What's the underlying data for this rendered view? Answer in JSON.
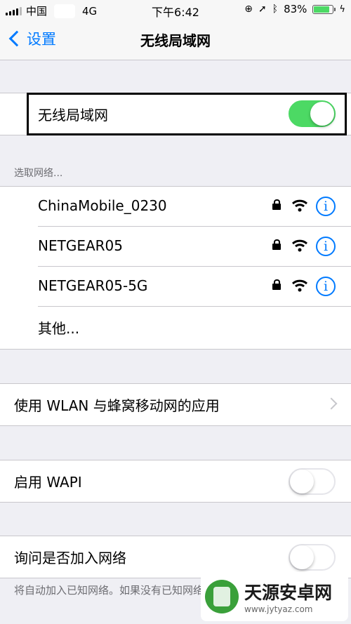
{
  "status_bar": {
    "carrier": "中国",
    "network": "4G",
    "time": "下午6:42",
    "battery": "83%",
    "battery_level": 0.83
  },
  "nav": {
    "back_label": "设置",
    "title": "无线局域网"
  },
  "wifi_toggle": {
    "label": "无线局域网",
    "on": true
  },
  "section_header": "选取网络...",
  "networks": [
    {
      "name": "ChinaMobile_0230",
      "secured": true
    },
    {
      "name": "NETGEAR05",
      "secured": true
    },
    {
      "name": "NETGEAR05-5G",
      "secured": true
    }
  ],
  "other_label": "其他...",
  "wlan_apps_label": "使用 WLAN 与蜂窝移动网的应用",
  "wapi": {
    "label": "启用 WAPI",
    "on": false
  },
  "ask_join": {
    "label": "询问是否加入网络",
    "on": false
  },
  "footer": "将自动加入已知网络。如果没有已知网络，您必须手动选择。",
  "watermark": {
    "title": "天源安卓网",
    "url": "www.jytyaz.com"
  },
  "colors": {
    "accent": "#007aff",
    "toggle_on": "#4cd964"
  }
}
